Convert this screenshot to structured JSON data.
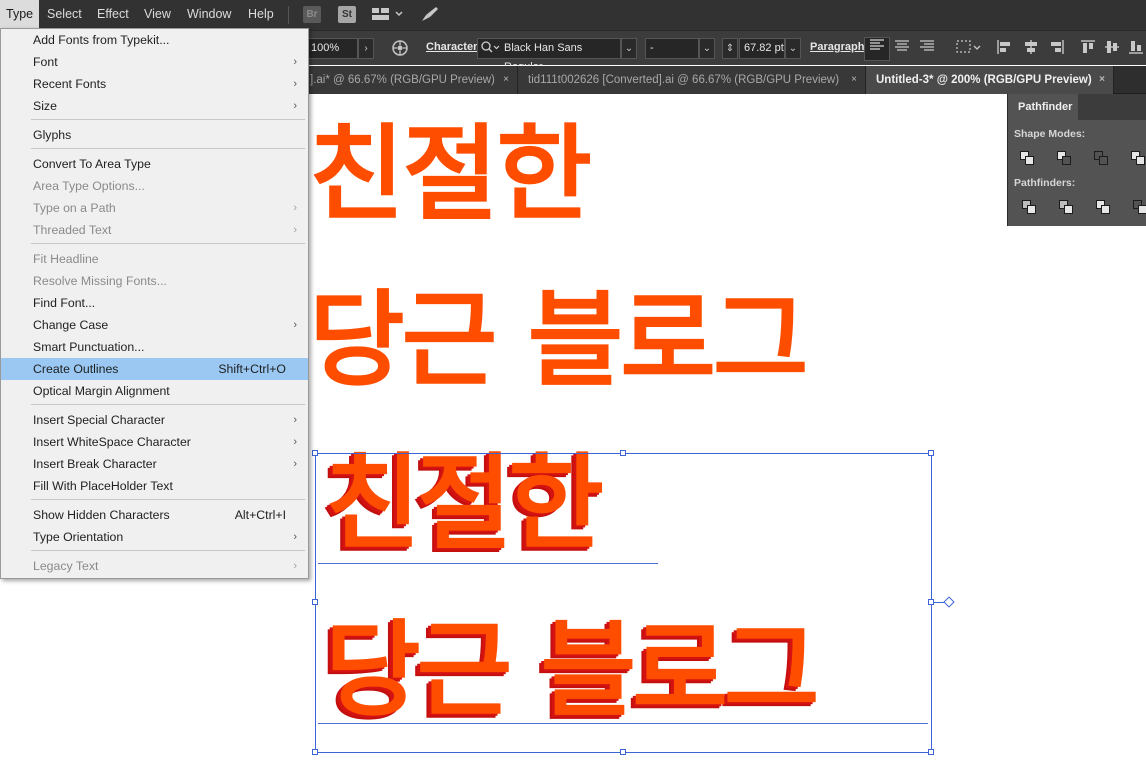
{
  "menubar": {
    "items": [
      "Type",
      "Select",
      "Effect",
      "View",
      "Window",
      "Help"
    ],
    "badges": {
      "bridge": "Br",
      "stock": "St"
    }
  },
  "control_bar": {
    "opacity": "100%",
    "character_label": "Character:",
    "font_family": "Black Han Sans Regular",
    "font_style": "-",
    "font_size": "67.82 pt",
    "paragraph_label": "Paragraph:"
  },
  "tabs": [
    {
      "label": "].ai* @ 66.67% (RGB/GPU Preview)",
      "close": "×"
    },
    {
      "label": "tid111t002626 [Converted].ai @ 66.67% (RGB/GPU Preview)",
      "close": "×"
    },
    {
      "label": "Untitled-3* @ 200% (RGB/GPU Preview)",
      "close": "×"
    }
  ],
  "canvas": {
    "line1": "친절한",
    "line2": "당근 블로그",
    "line3": "친절한",
    "line4": "당근 블로그"
  },
  "pathfinder": {
    "title": "Pathfinder",
    "shape_modes_label": "Shape Modes:",
    "pathfinders_label": "Pathfinders:"
  },
  "type_menu": {
    "items": [
      {
        "label": "Add Fonts from Typekit...",
        "shortcut": "",
        "submenu": false,
        "disabled": false
      },
      {
        "label": "Font",
        "shortcut": "",
        "submenu": true,
        "disabled": false
      },
      {
        "label": "Recent Fonts",
        "shortcut": "",
        "submenu": true,
        "disabled": false
      },
      {
        "label": "Size",
        "shortcut": "",
        "submenu": true,
        "disabled": false
      },
      {
        "label": "Glyphs",
        "shortcut": "",
        "submenu": false,
        "disabled": false
      },
      {
        "label": "Convert To Area Type",
        "shortcut": "",
        "submenu": false,
        "disabled": false
      },
      {
        "label": "Area Type Options...",
        "shortcut": "",
        "submenu": false,
        "disabled": true
      },
      {
        "label": "Type on a Path",
        "shortcut": "",
        "submenu": true,
        "disabled": true
      },
      {
        "label": "Threaded Text",
        "shortcut": "",
        "submenu": true,
        "disabled": true
      },
      {
        "label": "Fit Headline",
        "shortcut": "",
        "submenu": false,
        "disabled": true
      },
      {
        "label": "Resolve Missing Fonts...",
        "shortcut": "",
        "submenu": false,
        "disabled": true
      },
      {
        "label": "Find Font...",
        "shortcut": "",
        "submenu": false,
        "disabled": false
      },
      {
        "label": "Change Case",
        "shortcut": "",
        "submenu": true,
        "disabled": false
      },
      {
        "label": "Smart Punctuation...",
        "shortcut": "",
        "submenu": false,
        "disabled": false
      },
      {
        "label": "Create Outlines",
        "shortcut": "Shift+Ctrl+O",
        "submenu": false,
        "disabled": false,
        "highlight": true
      },
      {
        "label": "Optical Margin Alignment",
        "shortcut": "",
        "submenu": false,
        "disabled": false
      },
      {
        "label": "Insert Special Character",
        "shortcut": "",
        "submenu": true,
        "disabled": false
      },
      {
        "label": "Insert WhiteSpace Character",
        "shortcut": "",
        "submenu": true,
        "disabled": false
      },
      {
        "label": "Insert Break Character",
        "shortcut": "",
        "submenu": true,
        "disabled": false
      },
      {
        "label": "Fill With PlaceHolder Text",
        "shortcut": "",
        "submenu": false,
        "disabled": false
      },
      {
        "label": "Show Hidden Characters",
        "shortcut": "Alt+Ctrl+I",
        "submenu": false,
        "disabled": false
      },
      {
        "label": "Type Orientation",
        "shortcut": "",
        "submenu": true,
        "disabled": false
      },
      {
        "label": "Legacy Text",
        "shortcut": "",
        "submenu": true,
        "disabled": true
      }
    ]
  },
  "colors": {
    "text_fill": "#ff4d00",
    "text_shadow": "#d51212",
    "selection": "#3d63d9",
    "menu_highlight": "#9ac8f2"
  }
}
